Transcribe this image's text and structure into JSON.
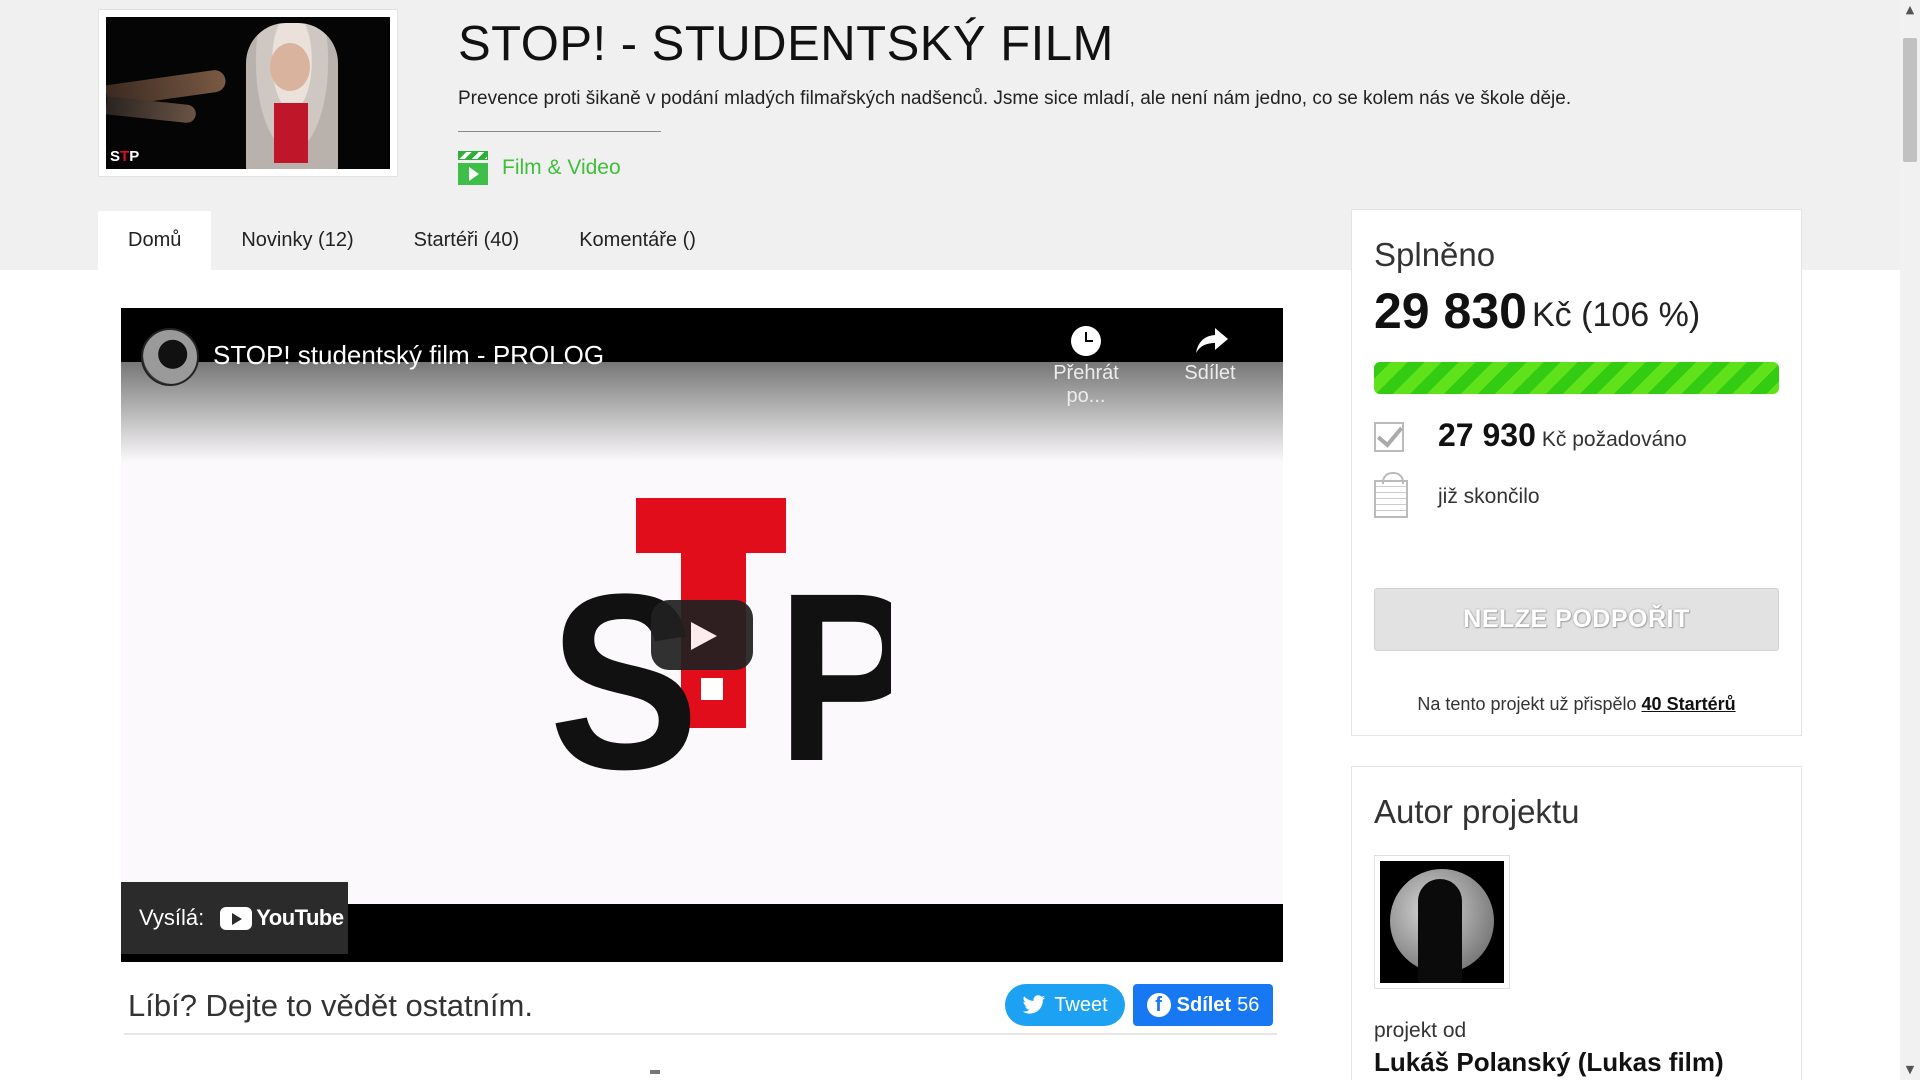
{
  "project": {
    "title": "STOP! - STUDENTSKÝ FILM",
    "description": "Prevence proti šikaně v podání mladých filmařských nadšenců. Jsme sice mladí, ale není nám jedno, co se kolem nás ve škole děje.",
    "category": "Film & Video",
    "thumbnail_logo_left": "S",
    "thumbnail_logo_red": "T",
    "thumbnail_logo_right": "P"
  },
  "tabs": [
    {
      "label": "Domů",
      "active": true
    },
    {
      "label": "Novinky (12)",
      "active": false
    },
    {
      "label": "Startéři (40)",
      "active": false
    },
    {
      "label": "Komentáře ()",
      "active": false
    }
  ],
  "video": {
    "title": "STOP! studentský film - PROLOG",
    "watch_later_label": "Přehrát po...",
    "share_label": "Sdílet",
    "broadcast_label": "Vysílá:",
    "platform": "YouTube",
    "logo_letters": [
      "S",
      "T",
      "P"
    ]
  },
  "share": {
    "question": "Líbí? Dejte to vědět ostatním.",
    "tweet_label": "Tweet",
    "fb_label": "Sdílet",
    "fb_count": "56"
  },
  "funding": {
    "heading": "Splněno",
    "amount": "29 830",
    "currency_percent": "Kč (106 %)",
    "progress_fraction": 1.0,
    "required_amount": "27 930",
    "required_label": "Kč požadováno",
    "status": "již skončilo",
    "button_label": "NELZE PODPOŘIT",
    "contrib_text": "Na tento projekt už přispělo",
    "contrib_link": "40 Startérů"
  },
  "author": {
    "heading": "Autor projektu",
    "by_label": "projekt od",
    "name": "Lukáš Polanský (Lukas film)"
  },
  "colors": {
    "accent_green": "#3fbf3a",
    "progress_green": "#33cc12",
    "stop_red": "#e20d1a",
    "twitter_blue": "#1da1f2",
    "facebook_blue": "#1877f2"
  }
}
